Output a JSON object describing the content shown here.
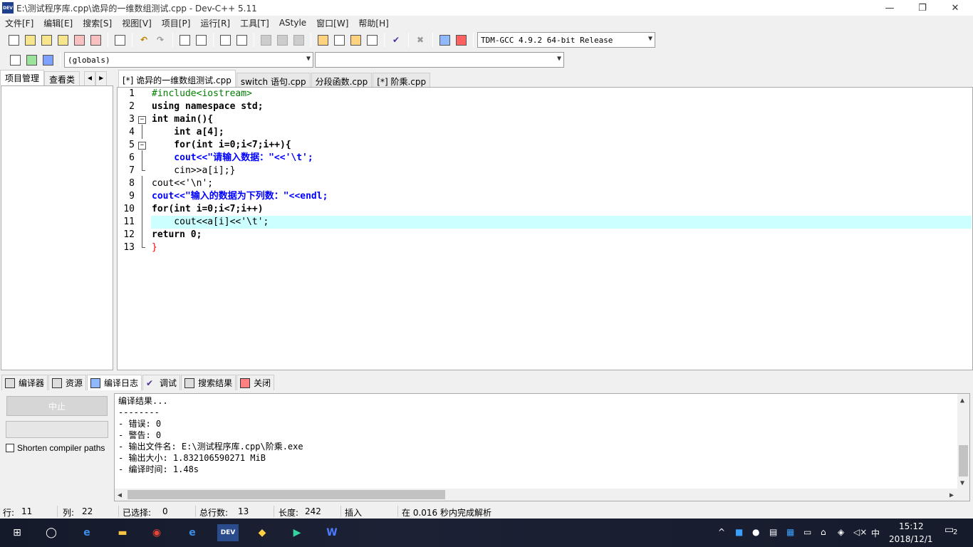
{
  "window": {
    "app_icon_text": "DEV",
    "title": "E:\\测试程序库.cpp\\诡异的一维数组测试.cpp - Dev-C++ 5.11"
  },
  "menu": [
    "文件[F]",
    "编辑[E]",
    "搜索[S]",
    "视图[V]",
    "项目[P]",
    "运行[R]",
    "工具[T]",
    "AStyle",
    "窗口[W]",
    "帮助[H]"
  ],
  "toolbar": {
    "compiler_select": "TDM-GCC 4.9.2 64-bit Release",
    "scope_select": "(globals)",
    "function_select": ""
  },
  "left_tabs": [
    "项目管理",
    "查看类"
  ],
  "file_tabs": [
    "[*] 诡异的一维数组测试.cpp",
    "switch 语句.cpp",
    "分段函数.cpp",
    "[*] 阶乘.cpp"
  ],
  "editor": {
    "current_line": 11,
    "lines": [
      {
        "n": "1",
        "text": "#include<iostream>"
      },
      {
        "n": "2",
        "text": "using namespace std;"
      },
      {
        "n": "3",
        "text": "int main(){"
      },
      {
        "n": "4",
        "text": "    int a[4];"
      },
      {
        "n": "5",
        "text": "    for(int i=0;i<7;i++){"
      },
      {
        "n": "6",
        "text": "    cout<<\"请输入数据：\"<<'\\t';"
      },
      {
        "n": "7",
        "text": "    cin>>a[i];}"
      },
      {
        "n": "8",
        "text": "cout<<'\\n';"
      },
      {
        "n": "9",
        "text": "cout<<\"输入的数据为下列数：\"<<endl;"
      },
      {
        "n": "10",
        "text": "for(int i=0;i<7;i++)"
      },
      {
        "n": "11",
        "text": "    cout<<a[i]<<'\\t';"
      },
      {
        "n": "12",
        "text": "return 0;"
      },
      {
        "n": "13",
        "text": "}"
      }
    ]
  },
  "bottom_tabs": [
    "编译器",
    "资源",
    "编译日志",
    "调试",
    "搜索结果",
    "关闭"
  ],
  "bottom": {
    "stop_button": "中止",
    "shorten_paths": "Shorten compiler paths",
    "log": [
      "编译结果...",
      "--------",
      "- 错误: 0",
      "- 警告: 0",
      "- 输出文件名: E:\\测试程序库.cpp\\阶乘.exe",
      "- 输出大小: 1.832106590271 MiB",
      "- 编译时间: 1.48s"
    ]
  },
  "status": {
    "row_label": "行:",
    "row": "11",
    "col_label": "列:",
    "col": "22",
    "sel_label": "已选择:",
    "sel": "0",
    "lines_label": "总行数:",
    "lines": "13",
    "len_label": "长度:",
    "len": "242",
    "mode": "插入",
    "parse": "在 0.016 秒内完成解析"
  },
  "taskbar": {
    "ime": "中",
    "time": "15:12",
    "date": "2018/12/1",
    "notif_count": "2"
  }
}
